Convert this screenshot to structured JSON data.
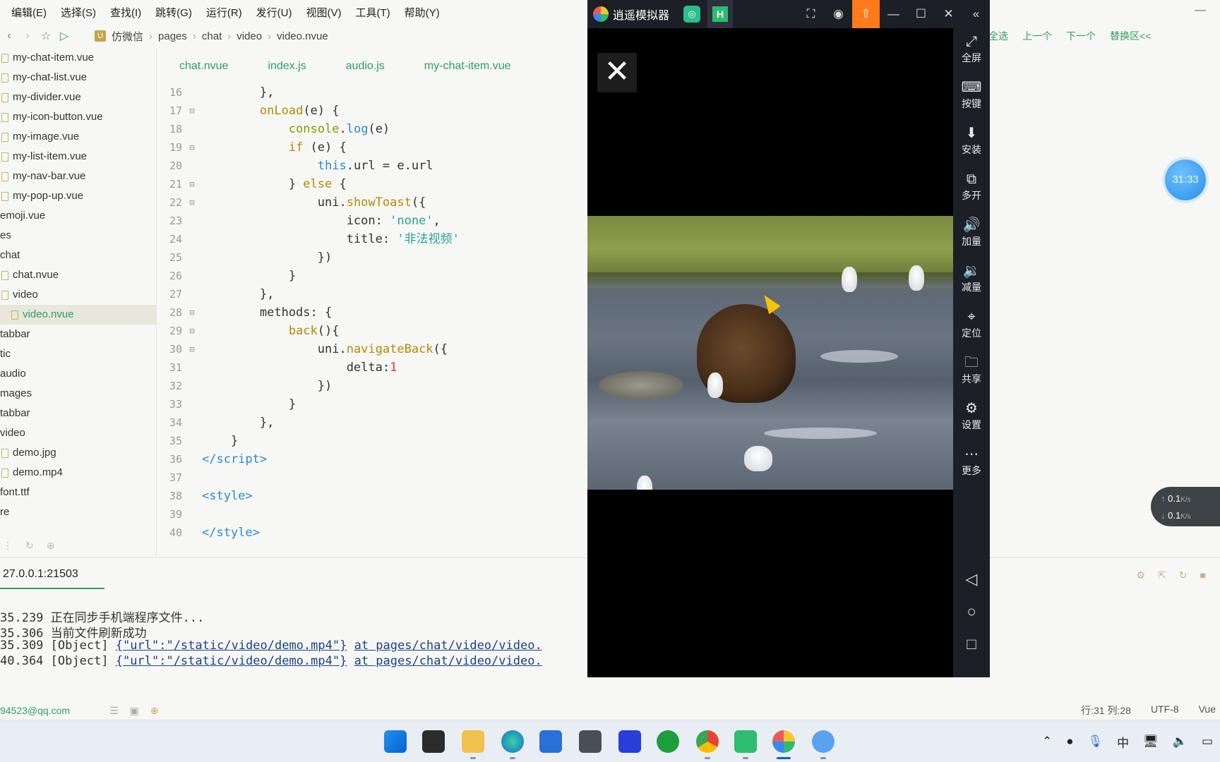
{
  "menubar": {
    "items": [
      "编辑(E)",
      "选择(S)",
      "查找(I)",
      "跳转(G)",
      "运行(R)",
      "发行(U)",
      "视图(V)",
      "工具(T)",
      "帮助(Y)"
    ]
  },
  "toolbar": {
    "breadcrumb": [
      "仿微信",
      "pages",
      "chat",
      "video",
      "video.nvue"
    ],
    "find_tools": [
      "全选",
      "上一个",
      "下一个",
      "替换区<<"
    ]
  },
  "sidebar": {
    "items": [
      {
        "label": "my-chat-item.vue",
        "indent": 1,
        "file": true
      },
      {
        "label": "my-chat-list.vue",
        "indent": 1,
        "file": true
      },
      {
        "label": "my-divider.vue",
        "indent": 1,
        "file": true
      },
      {
        "label": "my-icon-button.vue",
        "indent": 1,
        "file": true
      },
      {
        "label": "my-image.vue",
        "indent": 1,
        "file": true
      },
      {
        "label": "my-list-item.vue",
        "indent": 1,
        "file": true
      },
      {
        "label": "my-nav-bar.vue",
        "indent": 1,
        "file": true
      },
      {
        "label": "my-pop-up.vue",
        "indent": 1,
        "file": true
      },
      {
        "label": "emoji.vue",
        "indent": 0,
        "file": false
      },
      {
        "label": "es",
        "indent": 0,
        "file": false
      },
      {
        "label": "chat",
        "indent": 0,
        "file": false
      },
      {
        "label": "chat.nvue",
        "indent": 1,
        "file": true
      },
      {
        "label": "video",
        "indent": 1,
        "file": true
      },
      {
        "label": "video.nvue",
        "indent": 2,
        "file": true,
        "selected": true
      },
      {
        "label": "tabbar",
        "indent": 0,
        "file": false
      },
      {
        "label": "tic",
        "indent": 0,
        "file": false
      },
      {
        "label": "audio",
        "indent": 0,
        "file": false
      },
      {
        "label": "mages",
        "indent": 0,
        "file": false
      },
      {
        "label": "tabbar",
        "indent": 0,
        "file": false
      },
      {
        "label": "video",
        "indent": 0,
        "file": false
      },
      {
        "label": "demo.jpg",
        "indent": 1,
        "file": true
      },
      {
        "label": "demo.mp4",
        "indent": 1,
        "file": true
      },
      {
        "label": "font.ttf",
        "indent": 0,
        "file": false
      },
      {
        "label": "re",
        "indent": 0,
        "file": false
      }
    ]
  },
  "editor": {
    "tabs": [
      "chat.nvue",
      "index.js",
      "audio.js",
      "my-chat-item.vue"
    ],
    "lines": [
      {
        "n": "16",
        "fold": "",
        "html": "        },"
      },
      {
        "n": "17",
        "fold": "⊟",
        "html": "        <span class='kw'>onLoad</span>(e) {"
      },
      {
        "n": "18",
        "fold": "",
        "html": "            <span class='fn'>console</span>.<span class='tag'>log</span>(e)"
      },
      {
        "n": "19",
        "fold": "⊟",
        "html": "            <span class='kw'>if</span> (e) {"
      },
      {
        "n": "20",
        "fold": "",
        "html": "                <span class='tag'>this</span>.url = e.url"
      },
      {
        "n": "21",
        "fold": "⊟",
        "html": "            } <span class='kw'>else</span> {"
      },
      {
        "n": "22",
        "fold": "⊟",
        "html": "                uni.<span class='kw'>showToast</span>({"
      },
      {
        "n": "23",
        "fold": "",
        "html": "                    icon: <span class='str'>'none'</span>,"
      },
      {
        "n": "24",
        "fold": "",
        "html": "                    title: <span class='str'>'非法视频'</span>"
      },
      {
        "n": "25",
        "fold": "",
        "html": "                })"
      },
      {
        "n": "26",
        "fold": "",
        "html": "            }"
      },
      {
        "n": "27",
        "fold": "",
        "html": "        },"
      },
      {
        "n": "28",
        "fold": "⊟",
        "html": "        methods: {"
      },
      {
        "n": "29",
        "fold": "⊟",
        "html": "            <span class='kw'>back</span>(){"
      },
      {
        "n": "30",
        "fold": "⊟",
        "html": "                uni.<span class='kw'>navigateBack</span>({"
      },
      {
        "n": "31",
        "fold": "",
        "html": "                    delta:<span class='num'>1</span>"
      },
      {
        "n": "32",
        "fold": "",
        "html": "                })"
      },
      {
        "n": "33",
        "fold": "",
        "html": "            }"
      },
      {
        "n": "34",
        "fold": "",
        "html": "        },"
      },
      {
        "n": "35",
        "fold": "",
        "html": "    }"
      },
      {
        "n": "36",
        "fold": "",
        "html": "<span class='tag'>&lt;/script&gt;</span>"
      },
      {
        "n": "37",
        "fold": "",
        "html": ""
      },
      {
        "n": "38",
        "fold": "",
        "html": "<span class='tag'>&lt;style&gt;</span>"
      },
      {
        "n": "39",
        "fold": "",
        "html": ""
      },
      {
        "n": "40",
        "fold": "",
        "html": "<span class='tag'>&lt;/style&gt;</span>"
      }
    ]
  },
  "console": {
    "address": "27.0.0.1:21503",
    "logs": [
      {
        "time": "35.239",
        "text": "正在同步手机端程序文件...",
        "obj": "",
        "link": ""
      },
      {
        "time": "35.306",
        "text": "当前文件刷新成功",
        "obj": "",
        "link": ""
      },
      {
        "time": "35.309",
        "text": "[Object]",
        "obj": "{\"url\":\"/static/video/demo.mp4\"}",
        "link": "at pages/chat/video/video."
      },
      {
        "time": "40.364",
        "text": "[Object]",
        "obj": "{\"url\":\"/static/video/demo.mp4\"}",
        "link": "at pages/chat/video/video."
      }
    ]
  },
  "statusbar": {
    "email": "94523@qq.com",
    "position": "行:31  列:28",
    "encoding": "UTF-8",
    "lang": "Vue"
  },
  "emulator": {
    "title": "逍遥模拟器",
    "side_buttons": [
      {
        "label": "全屏",
        "icon": "⤢"
      },
      {
        "label": "按键",
        "icon": "⌨"
      },
      {
        "label": "安装",
        "icon": "⬇"
      },
      {
        "label": "多开",
        "icon": "⧉"
      },
      {
        "label": "加量",
        "icon": "🔊"
      },
      {
        "label": "减量",
        "icon": "🔉"
      },
      {
        "label": "定位",
        "icon": "⌖"
      },
      {
        "label": "共享",
        "icon": "🗀"
      },
      {
        "label": "设置",
        "icon": "⚙"
      },
      {
        "label": "更多",
        "icon": "⋯"
      }
    ]
  },
  "widgets": {
    "timer": "31:33",
    "net_up": "0.1",
    "net_down": "0.1",
    "net_unit": "K/s"
  },
  "taskbar": {
    "tray_lang": "中"
  },
  "colors": {
    "accent_green": "#2e9e63",
    "emulator_dark": "#1d1f27",
    "upload_orange": "#ff7a1a"
  }
}
